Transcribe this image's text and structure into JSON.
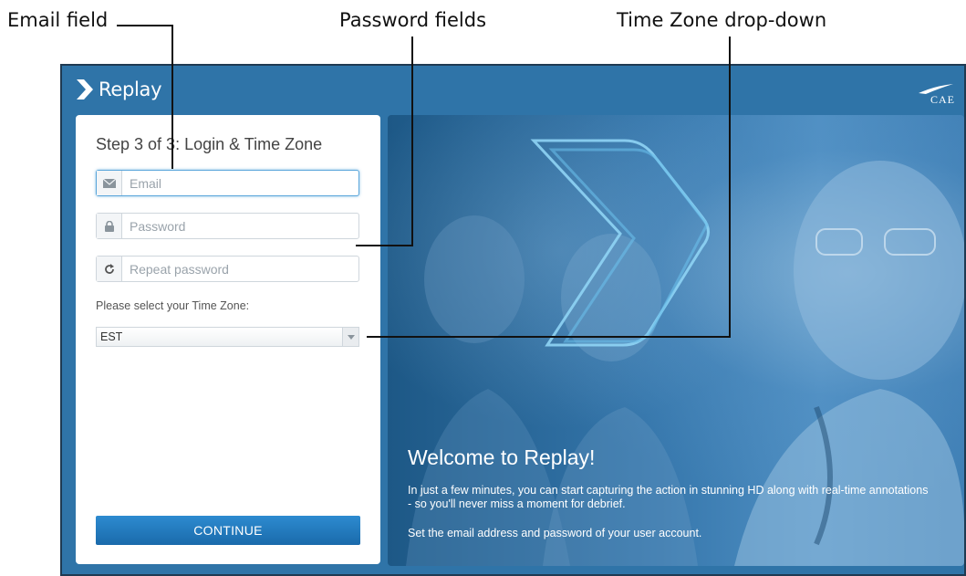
{
  "annotations": {
    "email_field": "Email field",
    "password_fields": "Password fields",
    "timezone_dropdown": "Time Zone drop-down"
  },
  "app": {
    "brand_name": "Replay",
    "partner_logo_text": "CAE",
    "colors": {
      "header_bg": "#2f74a8",
      "button": "#1f78bd",
      "focus": "#5aa6db"
    }
  },
  "form": {
    "step_title": "Step 3 of 3: Login & Time Zone",
    "email": {
      "placeholder": "Email",
      "value": "",
      "icon": "envelope-icon"
    },
    "password": {
      "placeholder": "Password",
      "value": "",
      "icon": "lock-icon"
    },
    "repeat_password": {
      "placeholder": "Repeat password",
      "value": "",
      "icon": "refresh-icon"
    },
    "timezone_label": "Please select your Time Zone:",
    "timezone_value": "EST",
    "continue_label": "CONTINUE"
  },
  "hero": {
    "title": "Welcome to Replay!",
    "paragraph1_line1": "In just a few minutes, you can start capturing the action in stunning HD along with real-time annotations",
    "paragraph1_line2": "- so you'll never miss a moment for debrief.",
    "paragraph2": "Set the email address and password of your user account."
  }
}
